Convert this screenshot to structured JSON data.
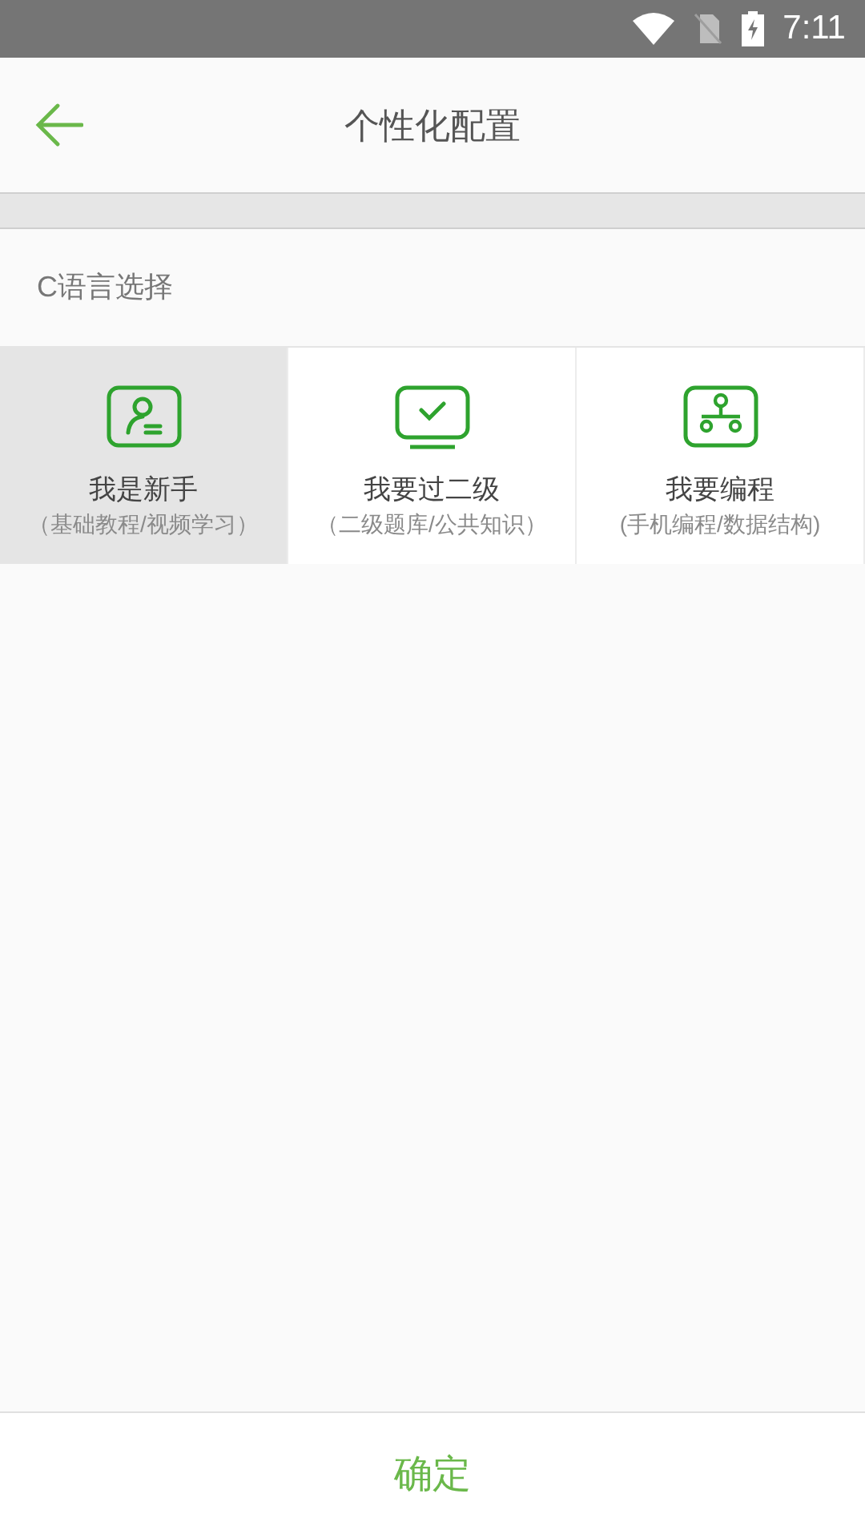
{
  "status_bar": {
    "time": "7:11"
  },
  "header": {
    "title": "个性化配置"
  },
  "section": {
    "label": "C语言选择"
  },
  "options": [
    {
      "kind": "beginner",
      "title": "我是新手",
      "subtitle": "（基础教程/视频学习）",
      "selected": true
    },
    {
      "kind": "exam",
      "title": "我要过二级",
      "subtitle": "（二级题库/公共知识）",
      "selected": false
    },
    {
      "kind": "coding",
      "title": "我要编程",
      "subtitle": "(手机编程/数据结构)",
      "selected": false
    }
  ],
  "confirm": {
    "label": "确定"
  }
}
